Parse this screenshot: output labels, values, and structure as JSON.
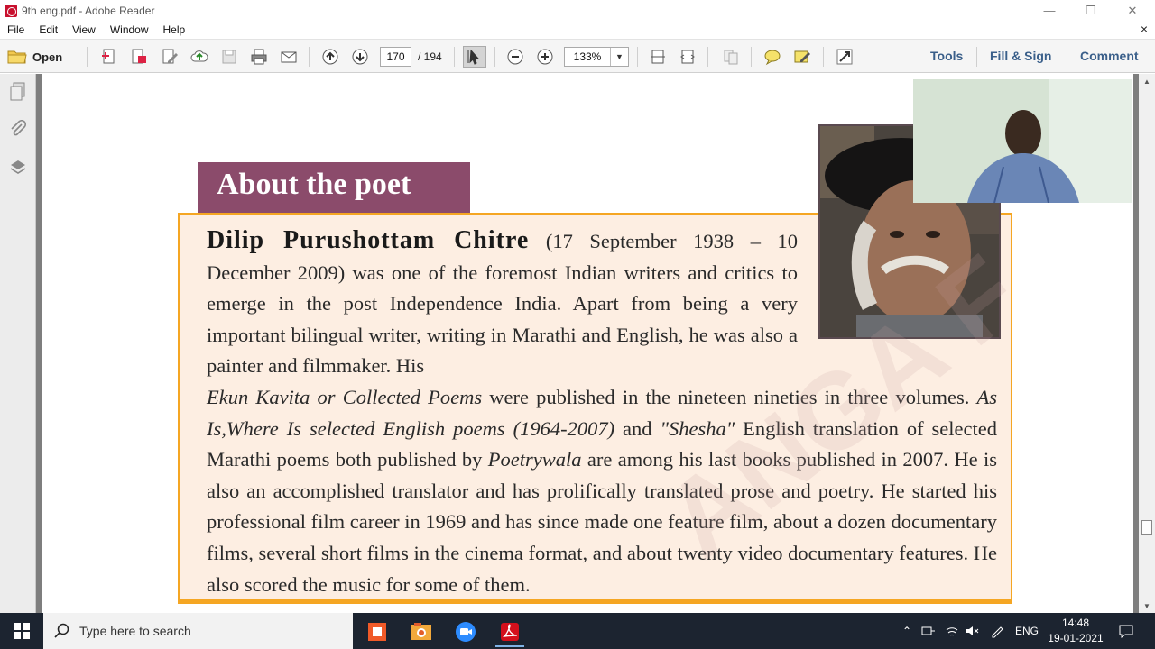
{
  "window": {
    "title": "9th eng.pdf - Adobe Reader",
    "controls": {
      "minimize": "—",
      "restore": "❐",
      "close": "✕"
    }
  },
  "menubar": {
    "items": [
      "File",
      "Edit",
      "View",
      "Window",
      "Help"
    ],
    "close_glyph": "×"
  },
  "toolbar": {
    "open_label": "Open",
    "current_page": "170",
    "total_pages": "/ 194",
    "zoom": "133%",
    "right_links": {
      "tools": "Tools",
      "fill_sign": "Fill & Sign",
      "comment": "Comment"
    },
    "icons": [
      "create-pdf-icon",
      "export-pdf-icon",
      "edit-pdf-icon",
      "upload-cloud-icon",
      "save-icon",
      "print-icon",
      "email-icon",
      "previous-page-icon",
      "next-page-icon",
      "select-tool-icon",
      "zoom-out-icon",
      "zoom-in-icon",
      "fit-page-icon",
      "fit-width-icon",
      "read-mode-icon",
      "sticky-note-icon",
      "highlight-icon",
      "fullscreen-icon"
    ]
  },
  "document": {
    "heading": "About the poet",
    "bio": {
      "name": "Dilip Purushottam Chitre",
      "dates_open": " (17 September 1938 – 10 December 2009) was one of the foremost Indian writers and critics to emerge in the post Independence India. Apart from being a very important bilingual writer, writing in Marathi and English, he was also a painter and filmmaker. His ",
      "title1": "Ekun Kavita or Collected Poems",
      "text2": " were published in the nineteen nineties in three volumes. ",
      "title2": "As Is,Where Is selected English poems (1964-2007)",
      "text3": " and ",
      "title3": "\"Shesha\"",
      "text4": " English translation of selected Marathi poems both published by ",
      "title4": "Poetrywala",
      "text5": " are among his last books published in 2007.  He is also an accomplished translator and has prolifically translated prose and poetry.  He started his professional film career in 1969 and has since made one feature film, about a dozen documentary films, several short films in the cinema format, and about twenty video documentary features.  He also scored the music for some of them."
    }
  },
  "taskbar": {
    "search_placeholder": "Type here to search",
    "language": "ENG",
    "time": "14:48",
    "date": "19-01-2021",
    "apps": [
      "screen-recorder-icon",
      "photo-viewer-icon",
      "zoom-app-icon",
      "adobe-reader-icon"
    ]
  },
  "colors": {
    "heading_bg": "#8b4b6b",
    "bio_bg": "#fdeee2",
    "bio_border": "#f5a623",
    "link_blue": "#3a5f8a",
    "taskbar_bg": "#1c2430"
  }
}
